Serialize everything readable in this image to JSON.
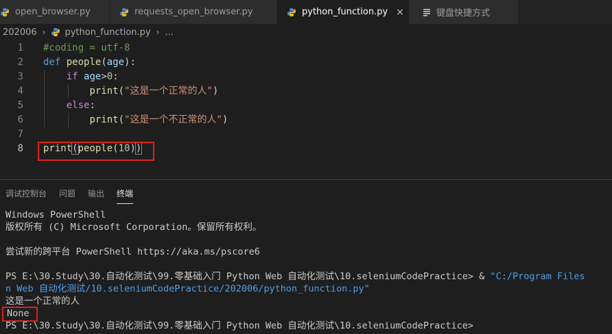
{
  "tabs": [
    {
      "label": "open_browser.py",
      "active": false
    },
    {
      "label": "requests_open_browser.py",
      "active": false
    },
    {
      "label": "python_function.py",
      "active": true,
      "close": "×"
    },
    {
      "label": "键盘快捷方式",
      "active": false
    }
  ],
  "breadcrumb": {
    "folder": "202006",
    "sep": "›",
    "file": "python_function.py",
    "more": "..."
  },
  "editor": {
    "lines": [
      {
        "n": "1",
        "tokens": [
          {
            "t": "#coding = utf-8",
            "c": "comment"
          }
        ]
      },
      {
        "n": "2",
        "tokens": [
          {
            "t": "def",
            "c": "kw"
          },
          {
            "t": " ",
            "c": "plain"
          },
          {
            "t": "people",
            "c": "fn"
          },
          {
            "t": "(",
            "c": "plain"
          },
          {
            "t": "age",
            "c": "param"
          },
          {
            "t": "):",
            "c": "plain"
          }
        ]
      },
      {
        "n": "3",
        "tokens": [
          {
            "t": "    ",
            "c": "plain"
          },
          {
            "t": "if",
            "c": "ctl"
          },
          {
            "t": " ",
            "c": "plain"
          },
          {
            "t": "age",
            "c": "param"
          },
          {
            "t": ">",
            "c": "plain"
          },
          {
            "t": "0",
            "c": "num"
          },
          {
            "t": ":",
            "c": "plain"
          }
        ]
      },
      {
        "n": "4",
        "tokens": [
          {
            "t": "        ",
            "c": "plain"
          },
          {
            "t": "print",
            "c": "fn"
          },
          {
            "t": "(",
            "c": "plain"
          },
          {
            "t": "\"这是一个正常的人\"",
            "c": "str"
          },
          {
            "t": ")",
            "c": "plain"
          }
        ]
      },
      {
        "n": "5",
        "tokens": [
          {
            "t": "    ",
            "c": "plain"
          },
          {
            "t": "else",
            "c": "ctl"
          },
          {
            "t": ":",
            "c": "plain"
          }
        ]
      },
      {
        "n": "6",
        "tokens": [
          {
            "t": "        ",
            "c": "plain"
          },
          {
            "t": "print",
            "c": "fn"
          },
          {
            "t": "(",
            "c": "plain"
          },
          {
            "t": "\"这是一个不正常的人\"",
            "c": "str"
          },
          {
            "t": ")",
            "c": "plain"
          }
        ]
      },
      {
        "n": "7",
        "tokens": []
      },
      {
        "n": "8",
        "tokens": [
          {
            "t": "print",
            "c": "fn"
          },
          {
            "t": "(",
            "c": "plain",
            "match": true
          },
          {
            "t": "people",
            "c": "fn"
          },
          {
            "t": "(",
            "c": "plain"
          },
          {
            "t": "10",
            "c": "num"
          },
          {
            "t": ")",
            "c": "plain"
          },
          {
            "t": ")",
            "c": "plain",
            "match": true
          }
        ]
      }
    ]
  },
  "panel": {
    "tabs": [
      {
        "label": "调试控制台",
        "active": false
      },
      {
        "label": "问题",
        "active": false
      },
      {
        "label": "输出",
        "active": false
      },
      {
        "label": "终端",
        "active": true
      }
    ]
  },
  "terminal": {
    "line1": "Windows PowerShell",
    "line2": "版权所有 (C) Microsoft Corporation。保留所有权利。",
    "line3": "尝试新的跨平台 PowerShell https://aka.ms/pscore6",
    "line4_prompt": "PS E:\\30.Study\\30.自动化测试\\99.零基础入门 Python Web 自动化测试\\10.seleniumCodePractice> ",
    "line4_amp": "& ",
    "line4_str": "\"C:/Program Files",
    "line5_str": "n Web 自动化测试/10.seleniumCodePractice/202006/python_function.py\"",
    "line6": "这是一个正常的人",
    "line7": "None",
    "line8": "PS E:\\30.Study\\30.自动化测试\\99.零基础入门 Python Web 自动化测试\\10.seleniumCodePractice>"
  },
  "colors": {
    "editor_bg": "#1e1e1e",
    "highlight_box": "#e02020",
    "python_icon_blue": "#3572a5",
    "python_icon_yellow": "#f1c232"
  },
  "icons": {
    "file_icon": "python-file-icon",
    "keyboard_icon": "keyboard-shortcuts-icon",
    "close_icon": "close-icon"
  }
}
